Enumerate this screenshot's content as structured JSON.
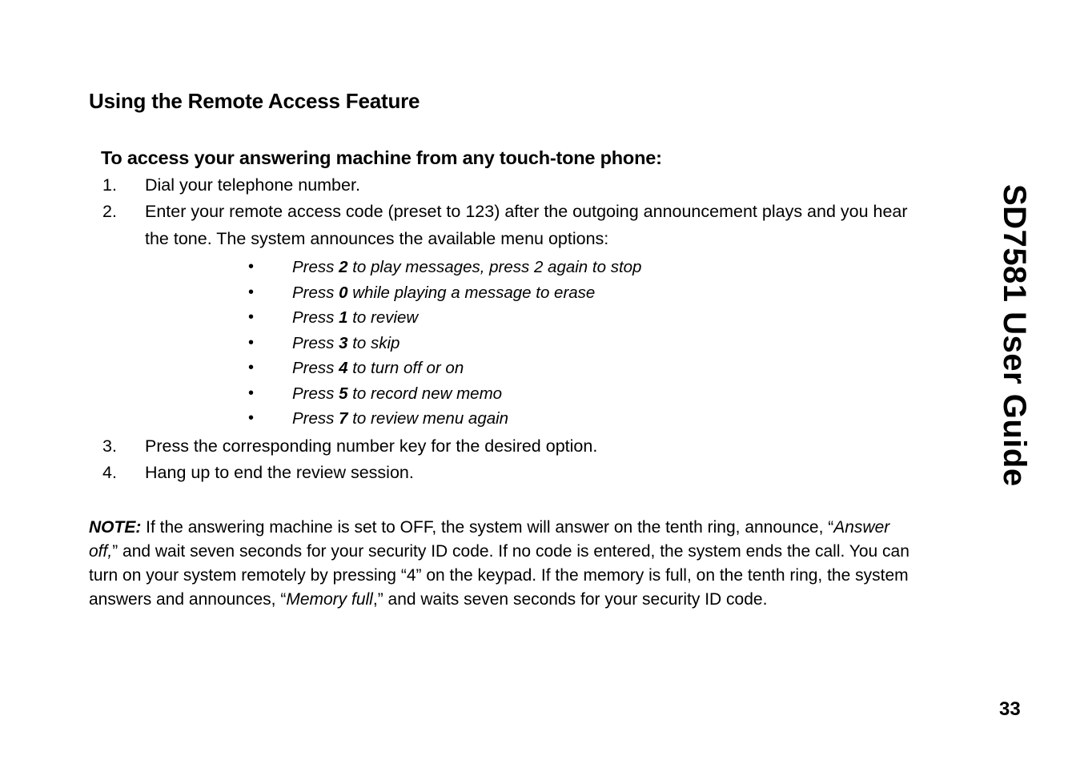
{
  "document": {
    "title": "Using the Remote Access Feature",
    "subheading": "To access your answering machine from any touch-tone phone:",
    "side_title": "SD7581 User Guide",
    "page_number": "33"
  },
  "steps": [
    {
      "number": "1.",
      "text": "Dial your telephone number."
    },
    {
      "number": "2.",
      "text": "Enter your remote access code (preset to 123) after the outgoing announcement plays and you hear the tone. The system announces the available menu options:"
    },
    {
      "number": "3.",
      "text": "Press the corresponding number key for the desired option."
    },
    {
      "number": "4.",
      "text": "Hang up to end the review session."
    }
  ],
  "menu_options": [
    {
      "bullet": "•",
      "prefix": "Press ",
      "key": "2",
      "suffix": " to play messages, press 2 again to stop"
    },
    {
      "bullet": "•",
      "prefix": "Press ",
      "key": "0",
      "suffix": " while playing a message to erase"
    },
    {
      "bullet": "•",
      "prefix": "Press ",
      "key": "1",
      "suffix": " to review"
    },
    {
      "bullet": "•",
      "prefix": "Press ",
      "key": "3",
      "suffix": " to skip"
    },
    {
      "bullet": "•",
      "prefix": "Press ",
      "key": "4",
      "suffix": " to turn off or on"
    },
    {
      "bullet": "•",
      "prefix": "Press ",
      "key": "5",
      "suffix": " to record new memo"
    },
    {
      "bullet": "•",
      "prefix": "Press ",
      "key": "7",
      "suffix": " to review menu again"
    }
  ],
  "note": {
    "label": "NOTE:",
    "part1": " If the answering machine is set to OFF, the system will answer on the tenth ring, announce, “",
    "italic1": "Answer off,",
    "part2": "” and wait seven seconds for your security ID code. If no code is entered, the system ends the call. You can turn on your system remotely by pressing “4” on the keypad. If the memory is full, on the tenth ring, the system answers and announces, “",
    "italic2": "Memory full",
    "part3": ",” and waits seven seconds for your security ID code."
  }
}
